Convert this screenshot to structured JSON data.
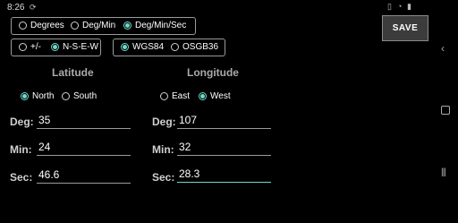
{
  "status_bar": {
    "time": "8:26",
    "left_icon": "sync-icon",
    "right_icons": [
      "vibrate-icon",
      "wifi-icon",
      "battery-icon"
    ]
  },
  "format_options": {
    "degrees": "Degrees",
    "deg_min": "Deg/Min",
    "deg_min_sec": "Deg/Min/Sec",
    "selected": "deg_min_sec"
  },
  "sign_options": {
    "plus_minus": "+/-",
    "nsew": "N-S-E-W",
    "selected": "nsew"
  },
  "datum_options": {
    "wgs84": "WGS84",
    "osgb36": "OSGB36",
    "selected": "wgs84"
  },
  "save_label": "SAVE",
  "latitude": {
    "heading": "Latitude",
    "north": "North",
    "south": "South",
    "selected": "north",
    "deg_label": "Deg:",
    "min_label": "Min:",
    "sec_label": "Sec:",
    "deg": "35",
    "min": "24",
    "sec": "46.6"
  },
  "longitude": {
    "heading": "Longitude",
    "east": "East",
    "west": "West",
    "selected": "west",
    "deg_label": "Deg:",
    "min_label": "Min:",
    "sec_label": "Sec:",
    "deg": "107",
    "min": "32",
    "sec": "28.3"
  },
  "colors": {
    "accent": "#6fd9c8",
    "background": "#000000"
  }
}
